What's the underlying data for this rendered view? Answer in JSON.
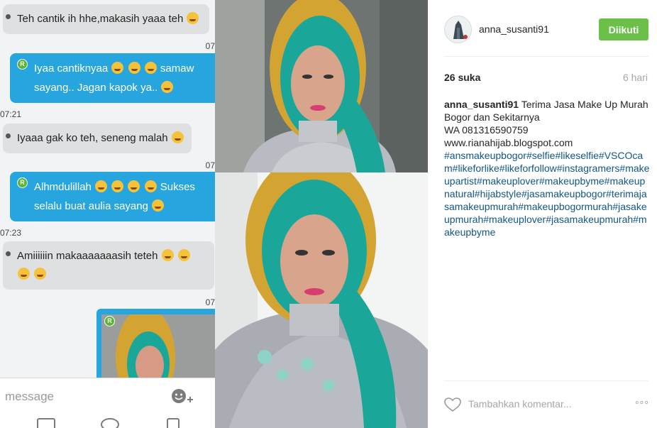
{
  "chat": {
    "messages": [
      {
        "dir": "in",
        "text": "Teh cantik ih hhe,makasih yaaa teh"
      },
      {
        "dir": "out",
        "text_line1": "Iyaa cantiknyaa",
        "text_line1_tail": "samaw",
        "text_line2": "sayang.. Jagan kapok ya.."
      },
      {
        "dir": "in",
        "text": "Iyaaa gak ko teh, seneng malah"
      },
      {
        "dir": "out",
        "text_line1": "Alhmdulillah",
        "text_line1_tail": "Sukses",
        "text_line2": "selalu buat aulia sayang"
      },
      {
        "dir": "in",
        "text_line1": "Amiiiiiin makaaaaaaasih teteh"
      }
    ],
    "timestamps": {
      "t1": "07",
      "t2": "07:21",
      "t3": "07",
      "t4": "07:23",
      "t5": "07"
    },
    "badge": "R",
    "compose_placeholder": "message"
  },
  "post": {
    "username": "anna_susanti91",
    "follow_label": "Diikuti",
    "likes": "26 suka",
    "age": "6 hari",
    "caption_user": "anna_susanti91",
    "caption_text": "Terima Jasa Make Up Murah Bogor dan Sekitarnya",
    "caption_wa": "WA 081316590759",
    "caption_url": "www.rianahijab.blogspot.com",
    "caption_tags": "#ansmakeupbogor#selfie#likeselfie#VSCOcam#likeforlike#likeforfollow#instagramers#makeupartist#makeuplover#makeupbyme#makeupnatural#hijabstyle#jasamakeupbogor#terimajasamakeupmurah#makeupbogormurah#jasakeupmurah#makeuplover#jasamakeupmurah#makeupbyme",
    "comment_placeholder": "Tambahkan komentar...",
    "more_label": "◦◦◦"
  },
  "colors": {
    "chat_out": "#27a5df",
    "chat_in": "#dfe0e1",
    "follow_green": "#6cc04a",
    "hashtag_blue": "#125688",
    "hijab_teal": "#1aa79a",
    "hijab_gold": "#d4a433"
  }
}
